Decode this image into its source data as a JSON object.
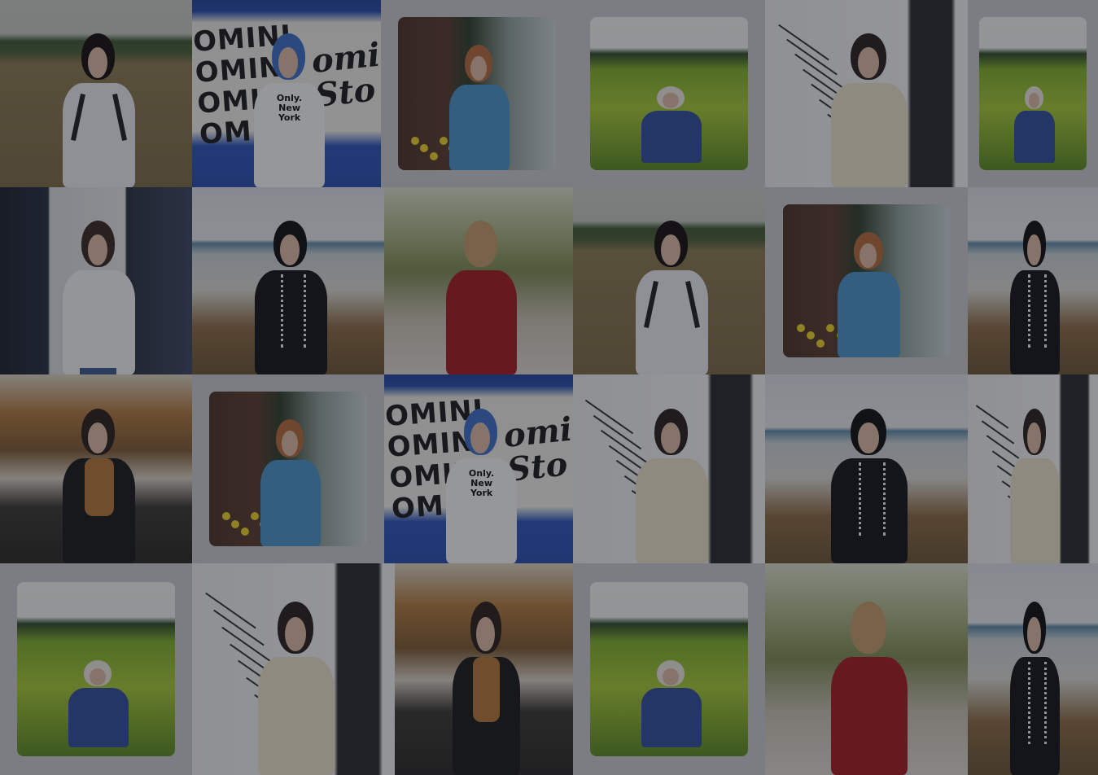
{
  "background": "#2b2d33",
  "wall_graffiti": {
    "block": "OMINI\nOMINI\nOMINI\nOMINI",
    "script": "omi Sto",
    "shirt_brand": "Only.",
    "shirt_sub": "New York"
  },
  "tiles": [
    {
      "scene": "field-white-top"
    },
    {
      "scene": "graffiti"
    },
    {
      "scene": "blue-hoodie",
      "framed": true
    },
    {
      "scene": "rapeseed",
      "framed": true
    },
    {
      "scene": "stairs-mask"
    },
    {
      "scene": "rapeseed",
      "framed": true
    },
    {
      "scene": "window-white"
    },
    {
      "scene": "river-black-lace"
    },
    {
      "scene": "park-red-back"
    },
    {
      "scene": "field-white-top"
    },
    {
      "scene": "blue-hoodie",
      "framed": true
    },
    {
      "scene": "river-black-lace"
    },
    {
      "scene": "autumn-street"
    },
    {
      "scene": "blue-hoodie",
      "framed": true
    },
    {
      "scene": "graffiti"
    },
    {
      "scene": "stairs-mask"
    },
    {
      "scene": "river-black-lace"
    },
    {
      "scene": "stairs-mask"
    },
    {
      "scene": "rapeseed",
      "framed": true
    },
    {
      "scene": "stairs-mask"
    },
    {
      "scene": "autumn-street"
    },
    {
      "scene": "rapeseed",
      "framed": true
    },
    {
      "scene": "park-red-back"
    },
    {
      "scene": "river-black-lace"
    }
  ]
}
